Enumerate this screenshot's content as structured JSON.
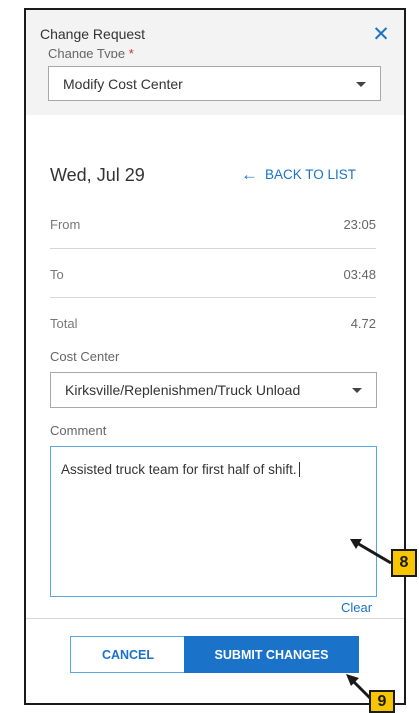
{
  "dialog": {
    "title": "Change Request",
    "close_symbol": "✕"
  },
  "change_type": {
    "label": "Change Type",
    "required_marker": "*",
    "selected": "Modify Cost Center"
  },
  "detail": {
    "date": "Wed, Jul 29",
    "back_label": "BACK TO LIST",
    "back_icon": "←",
    "rows": [
      {
        "label": "From",
        "value": "23:05"
      },
      {
        "label": "To",
        "value": "03:48"
      },
      {
        "label": "Total",
        "value": "4.72"
      }
    ]
  },
  "cost_center": {
    "label": "Cost Center",
    "selected": "Kirksville/Replenishmen/Truck Unload"
  },
  "comment": {
    "label": "Comment",
    "value": "Assisted truck team for first half of shift.",
    "clear_label": "Clear"
  },
  "actions": {
    "cancel_label": "CANCEL",
    "submit_label": "SUBMIT CHANGES"
  },
  "callouts": [
    {
      "number": "8"
    },
    {
      "number": "9"
    }
  ],
  "colors": {
    "accent": "#1a73c8",
    "callout": "#f7c600",
    "header_bg": "#f3f3f3"
  }
}
